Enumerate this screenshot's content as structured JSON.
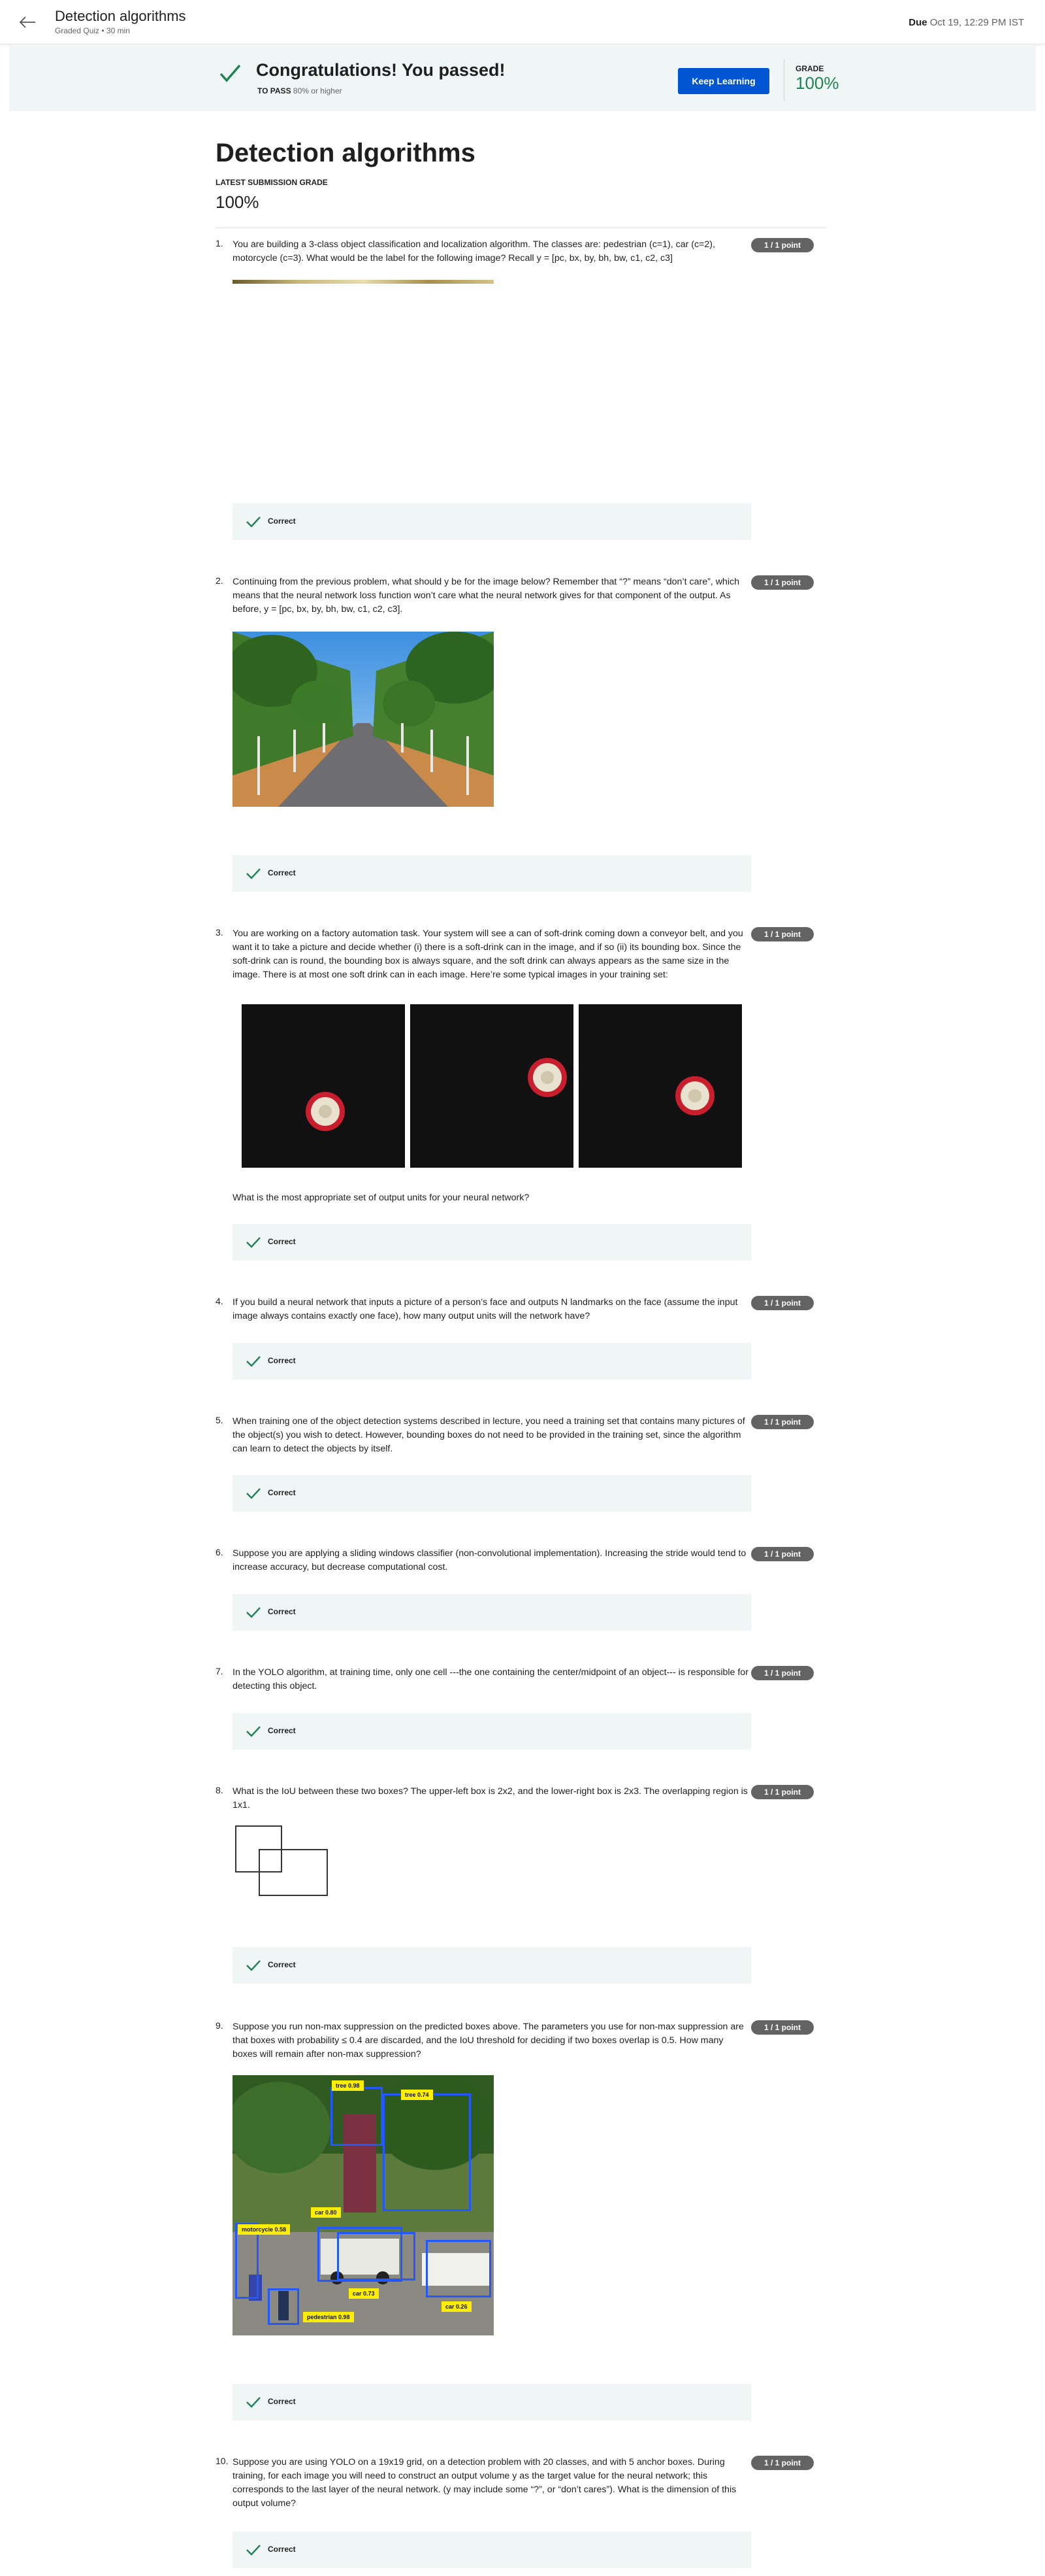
{
  "header": {
    "title": "Detection algorithms",
    "subtitle": "Graded Quiz • 30 min",
    "due_label": "Due",
    "due_value": "Oct 19, 12:29 PM IST"
  },
  "banner": {
    "title": "Congratulations! You passed!",
    "to_pass_label": "TO PASS",
    "to_pass_value": "80% or higher",
    "keep_learning": "Keep Learning",
    "grade_label": "GRADE",
    "grade_value": "100%"
  },
  "summary": {
    "title": "Detection algorithms",
    "latest_label": "LATEST SUBMISSION GRADE",
    "latest_value": "100%"
  },
  "correct_label": "Correct",
  "questions": [
    {
      "num": "1.",
      "points": "1 / 1 point",
      "text": "You are building a 3-class object classification and localization algorithm. The classes are: pedestrian (c=1), car (c=2), motorcycle (c=3). What would be the label for the following image? Recall y = [pc, bx, by, bh, bw, c1, c2, c3]"
    },
    {
      "num": "2.",
      "points": "1 / 1 point",
      "text": "Continuing from the previous problem, what should y be for the image below? Remember that “?” means “don’t care”, which means that the neural network loss function won’t care what the neural network gives for that component of the output. As before, y = [pc, bx, by, bh, bw, c1, c2, c3]."
    },
    {
      "num": "3.",
      "points": "1 / 1 point",
      "text": "You are working on a factory automation task. Your system will see a can of soft-drink coming down a conveyor belt, and you want it to take a picture and decide whether (i) there is a soft-drink can in the image, and if so (ii) its bounding box. Since the soft-drink can is round, the bounding box is always square, and the soft drink can always appears as the same size in the image. There is at most one soft drink can in each image. Here’re some typical images in your training set:",
      "followup": "What is the most appropriate set of output units for your neural network?"
    },
    {
      "num": "4.",
      "points": "1 / 1 point",
      "text": "If you build a neural network that inputs a picture of a person’s face and outputs N landmarks on the face (assume the input image always contains exactly one face), how many output units will the network have?"
    },
    {
      "num": "5.",
      "points": "1 / 1 point",
      "text": "When training one of the object detection systems described in lecture, you need a training set that contains many pictures of the object(s) you wish to detect. However, bounding boxes do not need to be provided in the training set, since the algorithm can learn to detect the objects by itself."
    },
    {
      "num": "6.",
      "points": "1 / 1 point",
      "text": "Suppose you are applying a sliding windows classifier (non-convolutional implementation). Increasing the stride would tend to increase accuracy, but decrease computational cost."
    },
    {
      "num": "7.",
      "points": "1 / 1 point",
      "text": "In the YOLO algorithm, at training time, only one cell ---the one containing the center/midpoint of an object--- is responsible for detecting this object."
    },
    {
      "num": "8.",
      "points": "1 / 1 point",
      "text": "What is the IoU between these two boxes? The upper-left box is 2x2, and the lower-right box is 2x3. The overlapping region is 1x1."
    },
    {
      "num": "9.",
      "points": "1 / 1 point",
      "text": "Suppose you run non-max suppression on the predicted boxes above. The parameters you use for non-max suppression are that boxes with probability ≤ 0.4 are discarded, and the IoU threshold for deciding if two boxes overlap is 0.5. How many boxes will remain after non-max suppression?"
    },
    {
      "num": "10.",
      "points": "1 / 1 point",
      "text": "Suppose you are using YOLO on a 19x19 grid, on a detection problem with 20 classes, and with 5 anchor boxes. During training, for each image you will need to construct an output volume y as the target value for the neural network; this corresponds to the last layer of the neural network. (y may include some “?”, or “don’t cares”). What is the dimension of this output volume?"
    }
  ],
  "q9_labels": {
    "tree1": "tree 0.98",
    "tree2": "tree 0.74",
    "car1": "car 0.80",
    "motorcycle": "motorcycle 0.58",
    "car2": "car 0.73",
    "car3": "car 0.26",
    "pedestrian": "pedestrian 0.98"
  }
}
